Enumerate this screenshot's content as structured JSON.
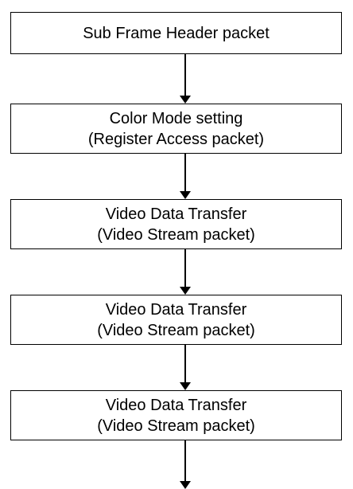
{
  "steps": [
    {
      "line1": "Sub Frame Header packet",
      "line2": ""
    },
    {
      "line1": "Color Mode setting",
      "line2": "(Register Access packet)"
    },
    {
      "line1": "Video Data Transfer",
      "line2": "(Video Stream packet)"
    },
    {
      "line1": "Video Data Transfer",
      "line2": "(Video Stream packet)"
    },
    {
      "line1": "Video Data Transfer",
      "line2": "(Video Stream packet)"
    }
  ]
}
